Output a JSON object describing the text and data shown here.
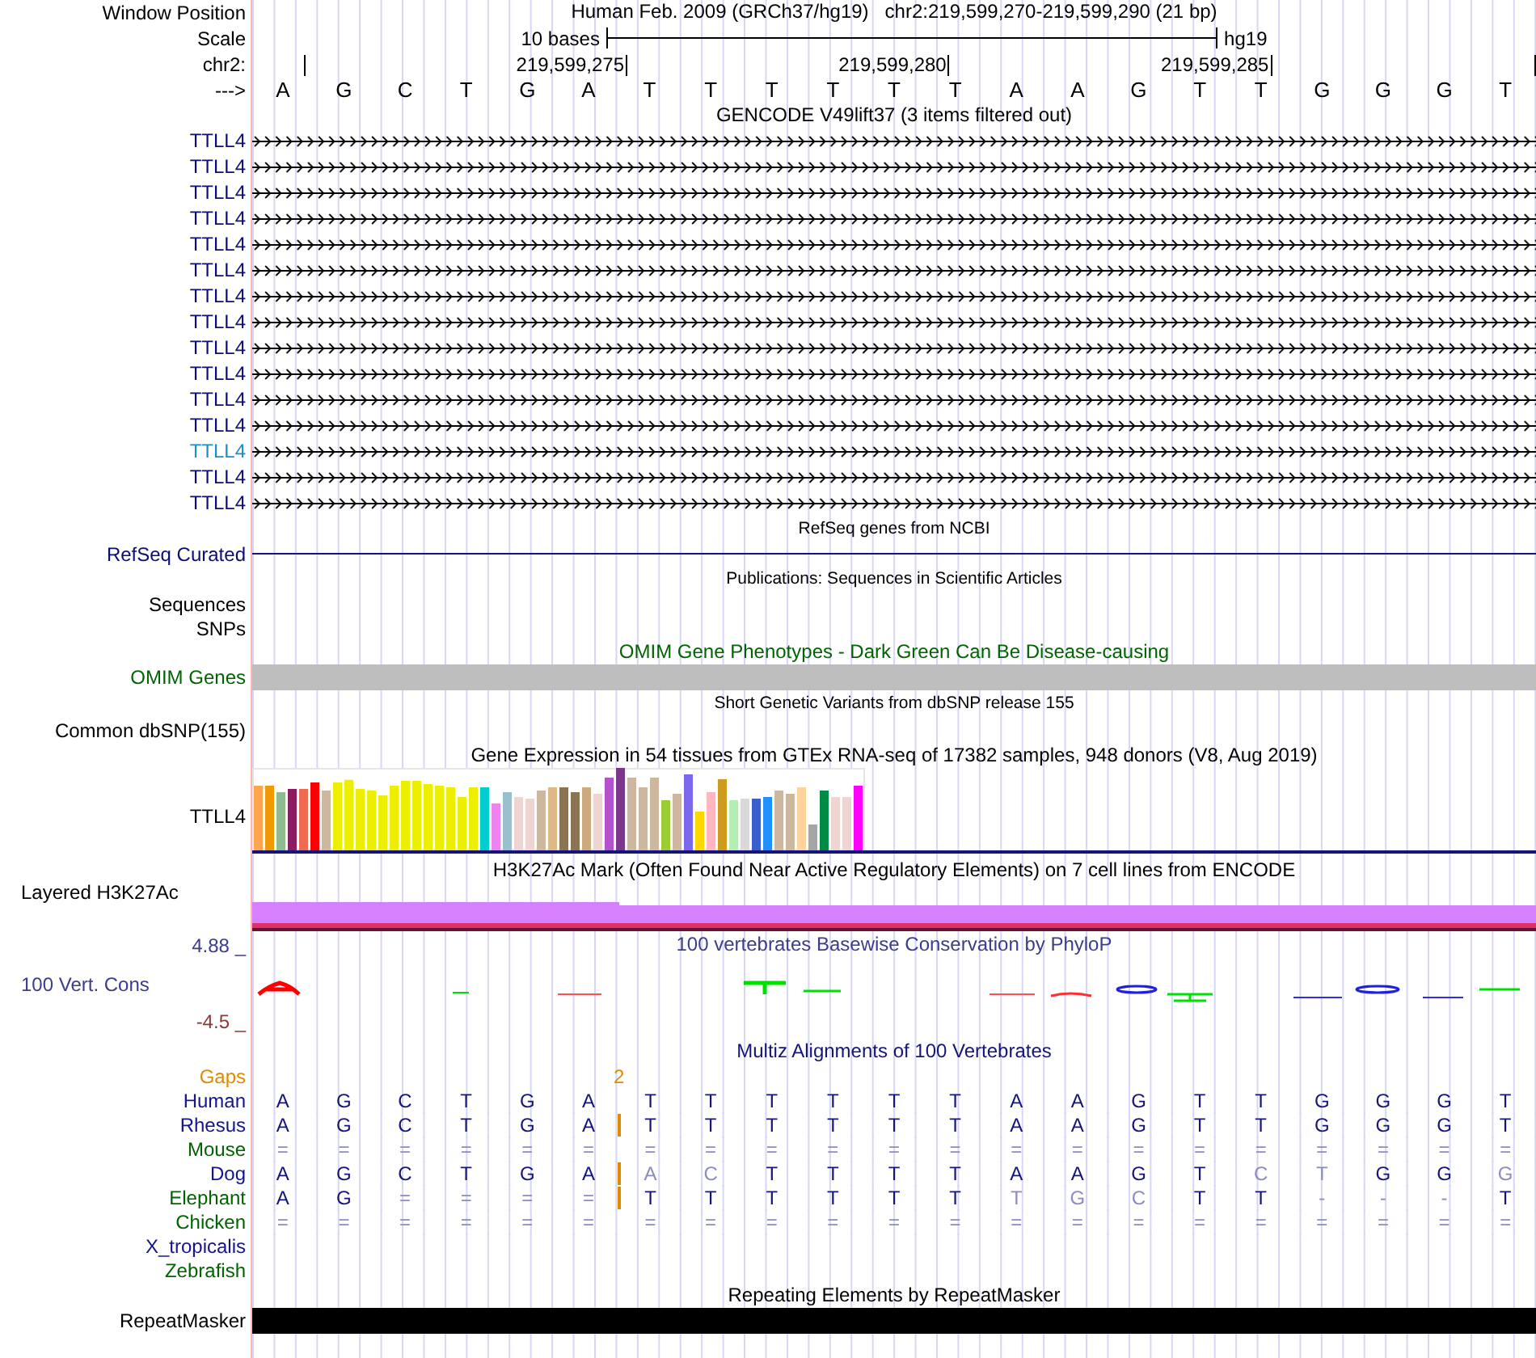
{
  "header": {
    "window_position": {
      "label": "Window Position",
      "text": "Human Feb. 2009 (GRCh37/hg19)   chr2:219,599,270-219,599,290 (21 bp)"
    },
    "scale": {
      "label": "Scale",
      "bar_label": "10 bases",
      "assembly": "hg19"
    },
    "ruler": {
      "label": "chr2:",
      "ticks": [
        "219,599,275",
        "219,599,280",
        "219,599,285"
      ]
    },
    "sequence": {
      "label": "--->",
      "bases": [
        "A",
        "G",
        "C",
        "T",
        "G",
        "A",
        "T",
        "T",
        "T",
        "T",
        "T",
        "T",
        "A",
        "A",
        "G",
        "T",
        "T",
        "G",
        "G",
        "G",
        "T"
      ]
    }
  },
  "gencode": {
    "title": "GENCODE V49lift37 (3 items filtered out)",
    "items": [
      {
        "label": "TTLL4",
        "highlighted": false
      },
      {
        "label": "TTLL4",
        "highlighted": false
      },
      {
        "label": "TTLL4",
        "highlighted": false
      },
      {
        "label": "TTLL4",
        "highlighted": false
      },
      {
        "label": "TTLL4",
        "highlighted": false
      },
      {
        "label": "TTLL4",
        "highlighted": false
      },
      {
        "label": "TTLL4",
        "highlighted": false
      },
      {
        "label": "TTLL4",
        "highlighted": false
      },
      {
        "label": "TTLL4",
        "highlighted": false
      },
      {
        "label": "TTLL4",
        "highlighted": false
      },
      {
        "label": "TTLL4",
        "highlighted": false
      },
      {
        "label": "TTLL4",
        "highlighted": false
      },
      {
        "label": "TTLL4",
        "highlighted": true
      },
      {
        "label": "TTLL4",
        "highlighted": false
      },
      {
        "label": "TTLL4",
        "highlighted": false
      }
    ]
  },
  "refseq": {
    "title": "RefSeq genes from NCBI",
    "label": "RefSeq Curated"
  },
  "publications": {
    "title": "Publications: Sequences in Scientific Articles",
    "labels": [
      "Sequences",
      "SNPs"
    ]
  },
  "omim": {
    "title": "OMIM Gene Phenotypes - Dark Green Can Be Disease-causing",
    "label": "OMIM Genes"
  },
  "dbsnp": {
    "title": "Short Genetic Variants from dbSNP release 155",
    "label": "Common dbSNP(155)"
  },
  "gtex": {
    "title": "Gene Expression in 54 tissues from GTEx RNA-seq of 17382 samples, 948 donors (V8, Aug 2019)",
    "label": "TTLL4"
  },
  "h3k27ac": {
    "title": "H3K27Ac Mark (Often Found Near Active Regulatory Elements) on 7 cell lines from ENCODE",
    "label": "Layered H3K27Ac"
  },
  "conservation": {
    "title": "100 vertebrates Basewise Conservation by PhyloP",
    "label": "100 Vert. Cons",
    "max": "4.88 _",
    "min": "-4.5 _"
  },
  "multiz": {
    "title": "Multiz Alignments of 100 Vertebrates",
    "gaps": {
      "label": "Gaps",
      "count": "2"
    },
    "species": [
      {
        "name": "Human",
        "color": "#14148c",
        "insertion": false,
        "cells": [
          {
            "text": "A",
            "dim": false
          },
          {
            "text": "G",
            "dim": false
          },
          {
            "text": "C",
            "dim": false
          },
          {
            "text": "T",
            "dim": false
          },
          {
            "text": "G",
            "dim": false
          },
          {
            "text": "A",
            "dim": false
          },
          {
            "text": "T",
            "dim": false
          },
          {
            "text": "T",
            "dim": false
          },
          {
            "text": "T",
            "dim": false
          },
          {
            "text": "T",
            "dim": false
          },
          {
            "text": "T",
            "dim": false
          },
          {
            "text": "T",
            "dim": false
          },
          {
            "text": "A",
            "dim": false
          },
          {
            "text": "A",
            "dim": false
          },
          {
            "text": "G",
            "dim": false
          },
          {
            "text": "T",
            "dim": false
          },
          {
            "text": "T",
            "dim": false
          },
          {
            "text": "G",
            "dim": false
          },
          {
            "text": "G",
            "dim": false
          },
          {
            "text": "G",
            "dim": false
          },
          {
            "text": "T",
            "dim": false
          }
        ]
      },
      {
        "name": "Rhesus",
        "color": "#14148c",
        "insertion": true,
        "cells": [
          {
            "text": "A",
            "dim": false
          },
          {
            "text": "G",
            "dim": false
          },
          {
            "text": "C",
            "dim": false
          },
          {
            "text": "T",
            "dim": false
          },
          {
            "text": "G",
            "dim": false
          },
          {
            "text": "A",
            "dim": false
          },
          {
            "text": "T",
            "dim": false
          },
          {
            "text": "T",
            "dim": false
          },
          {
            "text": "T",
            "dim": false
          },
          {
            "text": "T",
            "dim": false
          },
          {
            "text": "T",
            "dim": false
          },
          {
            "text": "T",
            "dim": false
          },
          {
            "text": "A",
            "dim": false
          },
          {
            "text": "A",
            "dim": false
          },
          {
            "text": "G",
            "dim": false
          },
          {
            "text": "T",
            "dim": false
          },
          {
            "text": "T",
            "dim": false
          },
          {
            "text": "G",
            "dim": false
          },
          {
            "text": "G",
            "dim": false
          },
          {
            "text": "G",
            "dim": false
          },
          {
            "text": "T",
            "dim": false
          }
        ]
      },
      {
        "name": "Mouse",
        "color": "#006400",
        "insertion": false,
        "cells": [
          {
            "text": "=",
            "dim": true
          },
          {
            "text": "=",
            "dim": true
          },
          {
            "text": "=",
            "dim": true
          },
          {
            "text": "=",
            "dim": true
          },
          {
            "text": "=",
            "dim": true
          },
          {
            "text": "=",
            "dim": true
          },
          {
            "text": "=",
            "dim": true
          },
          {
            "text": "=",
            "dim": true
          },
          {
            "text": "=",
            "dim": true
          },
          {
            "text": "=",
            "dim": true
          },
          {
            "text": "=",
            "dim": true
          },
          {
            "text": "=",
            "dim": true
          },
          {
            "text": "=",
            "dim": true
          },
          {
            "text": "=",
            "dim": true
          },
          {
            "text": "=",
            "dim": true
          },
          {
            "text": "=",
            "dim": true
          },
          {
            "text": "=",
            "dim": true
          },
          {
            "text": "=",
            "dim": true
          },
          {
            "text": "=",
            "dim": true
          },
          {
            "text": "=",
            "dim": true
          },
          {
            "text": "=",
            "dim": true
          }
        ]
      },
      {
        "name": "Dog",
        "color": "#14148c",
        "insertion": true,
        "cells": [
          {
            "text": "A",
            "dim": false
          },
          {
            "text": "G",
            "dim": false
          },
          {
            "text": "C",
            "dim": false
          },
          {
            "text": "T",
            "dim": false
          },
          {
            "text": "G",
            "dim": false
          },
          {
            "text": "A",
            "dim": false
          },
          {
            "text": "A",
            "dim": true
          },
          {
            "text": "C",
            "dim": true
          },
          {
            "text": "T",
            "dim": false
          },
          {
            "text": "T",
            "dim": false
          },
          {
            "text": "T",
            "dim": false
          },
          {
            "text": "T",
            "dim": false
          },
          {
            "text": "A",
            "dim": false
          },
          {
            "text": "A",
            "dim": false
          },
          {
            "text": "G",
            "dim": false
          },
          {
            "text": "T",
            "dim": false
          },
          {
            "text": "C",
            "dim": true
          },
          {
            "text": "T",
            "dim": true
          },
          {
            "text": "G",
            "dim": false
          },
          {
            "text": "G",
            "dim": false
          },
          {
            "text": "G",
            "dim": true
          }
        ]
      },
      {
        "name": "Elephant",
        "color": "#006400",
        "insertion": true,
        "cells": [
          {
            "text": "A",
            "dim": false
          },
          {
            "text": "G",
            "dim": false
          },
          {
            "text": "=",
            "dim": true
          },
          {
            "text": "=",
            "dim": true
          },
          {
            "text": "=",
            "dim": true
          },
          {
            "text": "=",
            "dim": true
          },
          {
            "text": "T",
            "dim": false
          },
          {
            "text": "T",
            "dim": false
          },
          {
            "text": "T",
            "dim": false
          },
          {
            "text": "T",
            "dim": false
          },
          {
            "text": "T",
            "dim": false
          },
          {
            "text": "T",
            "dim": false
          },
          {
            "text": "T",
            "dim": true
          },
          {
            "text": "G",
            "dim": true
          },
          {
            "text": "C",
            "dim": true
          },
          {
            "text": "T",
            "dim": false
          },
          {
            "text": "T",
            "dim": false
          },
          {
            "text": "-",
            "dim": true
          },
          {
            "text": "-",
            "dim": true
          },
          {
            "text": "-",
            "dim": true
          },
          {
            "text": "T",
            "dim": false
          }
        ]
      },
      {
        "name": "Chicken",
        "color": "#006400",
        "insertion": false,
        "cells": [
          {
            "text": "=",
            "dim": true
          },
          {
            "text": "=",
            "dim": true
          },
          {
            "text": "=",
            "dim": true
          },
          {
            "text": "=",
            "dim": true
          },
          {
            "text": "=",
            "dim": true
          },
          {
            "text": "=",
            "dim": true
          },
          {
            "text": "=",
            "dim": true
          },
          {
            "text": "=",
            "dim": true
          },
          {
            "text": "=",
            "dim": true
          },
          {
            "text": "=",
            "dim": true
          },
          {
            "text": "=",
            "dim": true
          },
          {
            "text": "=",
            "dim": true
          },
          {
            "text": "=",
            "dim": true
          },
          {
            "text": "=",
            "dim": true
          },
          {
            "text": "=",
            "dim": true
          },
          {
            "text": "=",
            "dim": true
          },
          {
            "text": "=",
            "dim": true
          },
          {
            "text": "=",
            "dim": true
          },
          {
            "text": "=",
            "dim": true
          },
          {
            "text": "=",
            "dim": true
          },
          {
            "text": "=",
            "dim": true
          }
        ]
      },
      {
        "name": "X_tropicalis",
        "color": "#14148c"
      },
      {
        "name": "Zebrafish",
        "color": "#006400"
      }
    ]
  },
  "repeatmasker": {
    "title": "Repeating Elements by RepeatMasker",
    "label": "RepeatMasker"
  }
}
